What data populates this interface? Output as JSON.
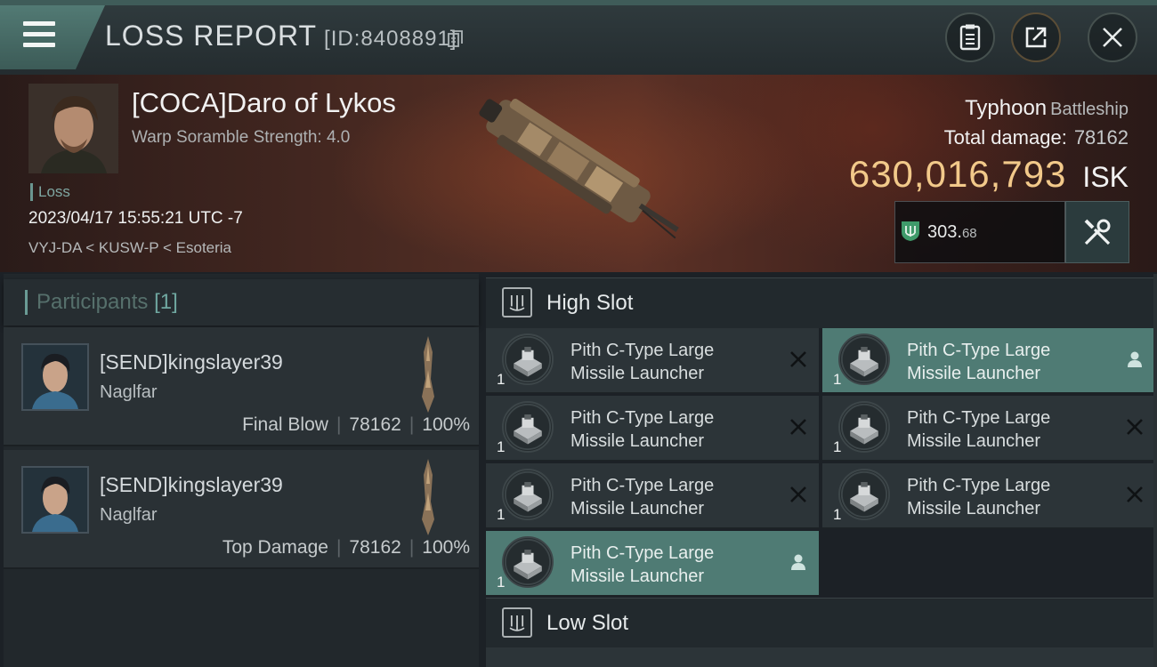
{
  "header": {
    "title": "LOSS REPORT",
    "report_id": "[ID:8408891]"
  },
  "victim": {
    "name": "[COCA]Daro of Lykos",
    "detail": "Warp Soramble Strength: 4.0",
    "status": "Loss",
    "datetime": "2023/04/17 15:55:21 UTC -7",
    "location": "VYJ-DA < KUSW-P < Esoteria"
  },
  "ship": {
    "name": "Typhoon",
    "class": "Battleship",
    "damage_label": "Total damage:",
    "damage_value": "78162",
    "isk_value": "630,016,793",
    "isk_unit": "ISK",
    "points_whole": "303.",
    "points_decimal": "68"
  },
  "participants": {
    "title": "Participants",
    "count": "[1]",
    "rows": [
      {
        "name": "[SEND]kingslayer39",
        "ship": "Naglfar",
        "role": "Final Blow",
        "damage": "78162",
        "percent": "100%"
      },
      {
        "name": "[SEND]kingslayer39",
        "ship": "Naglfar",
        "role": "Top Damage",
        "damage": "78162",
        "percent": "100%"
      }
    ]
  },
  "slots": {
    "high": {
      "label": "High Slot",
      "modules": [
        {
          "line1": "Pith C-Type Large",
          "line2": "Missile Launcher",
          "qty": "1",
          "status": "destroyed-x-icon"
        },
        {
          "line1": "Pith C-Type Large",
          "line2": "Missile Launcher",
          "qty": "1",
          "status": "dropped-person-icon"
        },
        {
          "line1": "Pith C-Type Large",
          "line2": "Missile Launcher",
          "qty": "1",
          "status": "destroyed-x-icon"
        },
        {
          "line1": "Pith C-Type Large",
          "line2": "Missile Launcher",
          "qty": "1",
          "status": "destroyed-x-icon"
        },
        {
          "line1": "Pith C-Type Large",
          "line2": "Missile Launcher",
          "qty": "1",
          "status": "destroyed-x-icon"
        },
        {
          "line1": "Pith C-Type Large",
          "line2": "Missile Launcher",
          "qty": "1",
          "status": "destroyed-x-icon"
        },
        {
          "line1": "Pith C-Type Large",
          "line2": "Missile Launcher",
          "qty": "1",
          "status": "dropped-person-icon"
        }
      ]
    },
    "low": {
      "label": "Low Slot"
    }
  },
  "colors": {
    "accent_teal": "#4f7b74",
    "isk_gold": "#f2c98a",
    "panel": "#2c3438"
  }
}
